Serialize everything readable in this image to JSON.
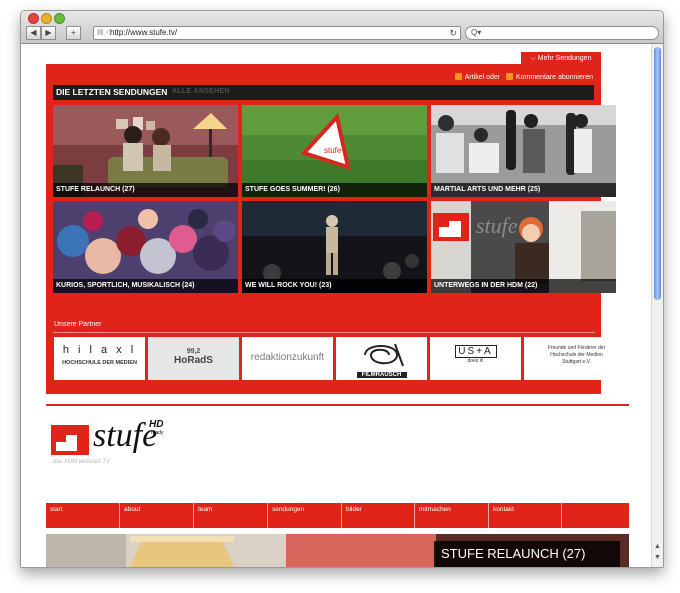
{
  "browser": {
    "back": "◀",
    "forward": "▶",
    "add": "+",
    "url_icon": "▤ ◁",
    "url": "http://www.stufe.tv/",
    "reload": "↻",
    "search_icon": "Q▾"
  },
  "panel": {
    "tab_label": "Mehr Sendungen",
    "subscribe_articles": "Artikel oder",
    "subscribe_comments": "Kommentare abonnieren",
    "heading": "DIE LETZTEN SENDUNGEN",
    "heading_link": "ALLE ANSEHEN",
    "tiles": [
      {
        "caption": "STUFE RELAUNCH (27)"
      },
      {
        "caption": "STUFE GOES SUMMER! (26)"
      },
      {
        "caption": "MARTIAL ARTS UND MEHR (25)"
      },
      {
        "caption": "KURIOS, SPORTLICH, MUSIKALISCH (24)"
      },
      {
        "caption": "WE WILL ROCK YOU! (23)"
      },
      {
        "caption": "UNTERWEGS IN DER HDM (22)"
      }
    ],
    "tile_sign_text": "stufe",
    "tile_screen_text": "stufe",
    "partners_heading": "Unsere Partner",
    "partners": [
      {
        "mark": "h i l a x l",
        "name": "HOCHSCHULE DER MEDIEN"
      },
      {
        "mark": "99,2",
        "name": "HoRadS"
      },
      {
        "mark": "",
        "name": "redaktionzukunft"
      },
      {
        "mark": "",
        "name": "FILMRAUSCH"
      },
      {
        "mark": "US+A",
        "name": "does it!"
      },
      {
        "mark": "",
        "name": "Freunde und Förderer der Hochschule der Medien Stuttgart e.V."
      }
    ]
  },
  "brand": {
    "name": "stufe",
    "badge": "HD",
    "badge_sub": "ready",
    "tagline": "das HdM webcast TV"
  },
  "menu": [
    "start",
    "about",
    "team",
    "sendungen",
    "bilder",
    "mitmachen",
    "kontakt"
  ],
  "hero": {
    "title": "STUFE RELAUNCH (27)"
  },
  "colors": {
    "brand_red": "#e12419",
    "caption_bg": "#000000",
    "scroll_thumb": "#5d8fd6"
  }
}
